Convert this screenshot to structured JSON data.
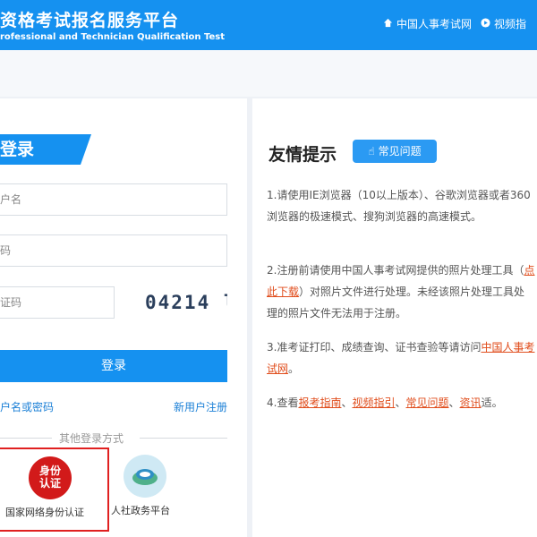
{
  "header": {
    "title_cn": "资格考试报名服务平台",
    "title_en": "rofessional and Technician Qualification Test",
    "nav": [
      {
        "icon": "home-icon",
        "label": "中国人事考试网"
      },
      {
        "icon": "play-icon",
        "label": "视频指"
      }
    ]
  },
  "login": {
    "tab_label": "登录",
    "username_placeholder": "户名",
    "password_placeholder": "码",
    "captcha_placeholder": "证码",
    "captcha_code": "04214 l",
    "login_button": "登录",
    "forgot_link": "户名或密码",
    "register_link": "新用户注册",
    "other_methods": "其他登录方式",
    "alt_methods": [
      {
        "icon": "identity-seal-icon",
        "seal_text": "身份认证",
        "label": "国家网络身份认证"
      },
      {
        "icon": "gov-service-icon",
        "label": "人社政务平台"
      }
    ]
  },
  "tips": {
    "title": "友情提示",
    "faq_button": "常见问题",
    "items": [
      {
        "text": "1.请使用IE浏览器（10以上版本）、谷歌浏览器或者360浏览器的极速模式、搜狗浏览器的高速模式。"
      },
      {
        "pre": "2.注册前请使用中国人事考试网提供的照片处理工具（",
        "link": "点此下载",
        "post": "）对照片文件进行处理。未经该照片处理工具处理的照片文件无法用于注册。"
      },
      {
        "pre": "3.准考证打印、成绩查询、证书查验等请访问",
        "red": "中国人事考试网",
        "post": "。"
      },
      {
        "pre": "4.查看",
        "links": [
          "报考指南",
          "视频指引",
          "常见问题",
          "资讯"
        ],
        "post": "适。"
      }
    ]
  },
  "colors": {
    "primary": "#1591f0",
    "highlight": "#e02020",
    "link": "#e04d1c"
  }
}
